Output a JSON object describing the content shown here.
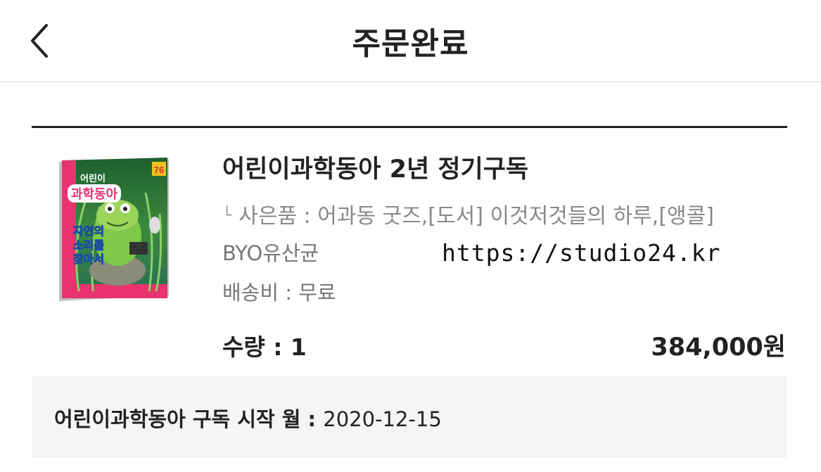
{
  "header": {
    "title": "주문완료",
    "back_icon": "chevron-left-icon"
  },
  "product": {
    "cover_masthead_top": "어린이",
    "cover_masthead_main": "과학동아",
    "cover_headline_1": "자연의",
    "cover_headline_2": "소리를",
    "cover_headline_3": "찾아서",
    "cover_issue": "76",
    "name": "어린이과학동아 2년 정기구독",
    "gift_prefix": "└",
    "gift": "사은품 : 어과동 굿즈,[도서] 이것저것들의 하루,[앵콜]",
    "option": "BYO유산균",
    "shipping": "배송비 : 무료",
    "quantity": "수량 : 1",
    "price": "384,000원"
  },
  "watermark": "https://studio24.kr",
  "subscription": {
    "label": "어린이과학동아 구독 시작 월 : ",
    "value": "2020-12-15"
  }
}
